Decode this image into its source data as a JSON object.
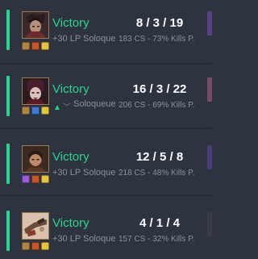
{
  "matches": [
    {
      "result": "Victory",
      "lp": "+30 LP Soloqueue",
      "lp_change_icons": false,
      "kda": "8 / 3 / 19",
      "stats": "183 CS - 73% Kills P.",
      "champion_icon": "champion-portrait-icon"
    },
    {
      "result": "Victory",
      "lp": "",
      "mode": "Soloqueue",
      "lp_change_icons": true,
      "kda": "16 / 3 / 22",
      "stats": "206 CS - 69% Kills P.",
      "champion_icon": "champion-portrait-icon"
    },
    {
      "result": "Victory",
      "lp": "+30 LP Soloqueue",
      "lp_change_icons": false,
      "kda": "12 / 5 / 8",
      "stats": "218 CS - 48% Kills P.",
      "champion_icon": "champion-portrait-icon"
    },
    {
      "result": "Victory",
      "lp": "+30 LP Soloqueue",
      "lp_change_icons": false,
      "kda": "4 / 1 / 4",
      "stats": "157 CS - 32% Kills P.",
      "champion_icon": "champion-portrait-icon"
    }
  ],
  "colors": {
    "background": "#2e3340",
    "victory": "#2bd48e",
    "muted_text": "#8b909b",
    "kda_text": "#ffffff"
  }
}
